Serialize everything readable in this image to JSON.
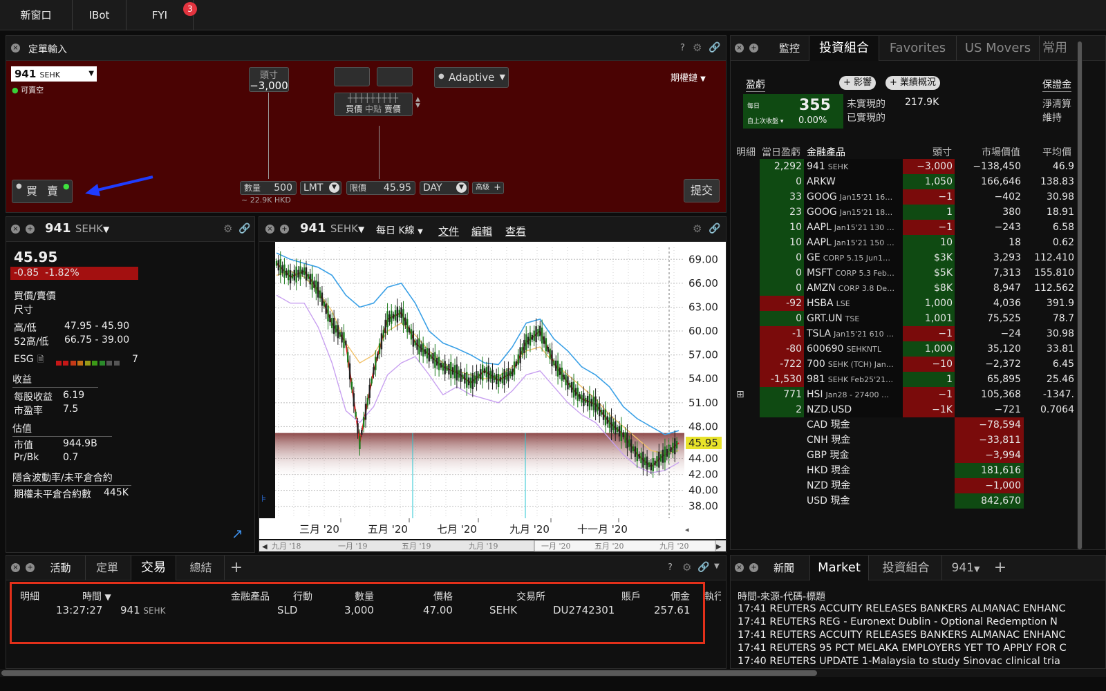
{
  "topbar": {
    "tabs": [
      "新窗口",
      "IBot",
      "FYI"
    ],
    "fyi_badge": "3"
  },
  "order_entry": {
    "title": "定單輸入",
    "symbol": "941",
    "exchange": "SEHK",
    "shortable": "可賣空",
    "position_label": "頭寸",
    "position_value": "−3,000",
    "bid_label": "買價",
    "mid_label": "中點",
    "ask_label": "賣價",
    "algo": "Adaptive",
    "options_chain": "期權鏈",
    "buy": "買",
    "sell": "賣",
    "qty_label": "數量",
    "qty_value": "500",
    "notional": "~ 22.9K HKD",
    "order_type": "LMT",
    "limit_label": "限價",
    "limit_value": "45.95",
    "tif": "DAY",
    "advanced": "高級",
    "submit": "提交"
  },
  "quote_panel": {
    "symbol": "941",
    "exchange": "SEHK",
    "last": "45.95",
    "change": "-0.85",
    "change_pct": "-1.82%",
    "bid_ask_label": "買價/賣價",
    "size_label": "尺寸",
    "hilo_label": "高/低",
    "hilo_value": "47.95 - 45.90",
    "hilo52_label": "52高/低",
    "hilo52_value": "66.75 - 39.00",
    "esg_label": "ESG",
    "esg_value": "7",
    "earnings_section": "收益",
    "eps_label": "每股收益",
    "eps_value": "6.19",
    "pe_label": "市盈率",
    "pe_value": "7.5",
    "valuation_section": "估值",
    "mktcap_label": "市值",
    "mktcap_value": "944.9B",
    "pb_label": "Pr/Bk",
    "pb_value": "0.7",
    "iv_section": "隱含波動率/未平倉合約",
    "oi_label": "期權未平倉合約數",
    "oi_value": "445K"
  },
  "chart_panel": {
    "symbol": "941",
    "exchange": "SEHK",
    "interval": "每日 K線",
    "menus": [
      "文件",
      "編輯",
      "查看"
    ],
    "last_price_tag": "45.95",
    "nav_labels": [
      "九月 '18",
      "一月 '19",
      "五月 '19",
      "九月 '19",
      "一月 '20",
      "五月 '20",
      "九月 '20"
    ]
  },
  "chart_data": {
    "type": "line",
    "title": "",
    "y_ticks": [
      69.0,
      66.0,
      63.0,
      60.0,
      57.0,
      54.0,
      51.0,
      48.0,
      44.0,
      42.0,
      40.0,
      38.0
    ],
    "ylim": [
      36.5,
      70.5
    ],
    "x_ticks": [
      "三月 '20",
      "五月 '20",
      "七月 '20",
      "九月 '20",
      "十一月 '20"
    ],
    "series": [
      {
        "values": [
          68.5,
          66.8,
          67.5,
          65.2,
          61.0,
          58.5,
          46.0,
          55.0,
          61.5,
          62.3,
          58.5,
          57.0,
          55.5,
          54.8,
          53.5,
          55.0,
          53.8,
          54.8,
          58.6,
          60.0,
          56.0,
          53.5,
          51.5,
          50.8,
          48.5,
          47.0,
          44.5,
          43.0,
          44.5,
          45.95
        ]
      },
      {
        "values": [
          67.0,
          67.5,
          66.8,
          65.0,
          62.5,
          58.5,
          56.0,
          57.0,
          60.0,
          61.0,
          59.5,
          57.5,
          56.0,
          55.0,
          54.5,
          54.0,
          54.3,
          55.5,
          57.5,
          58.0,
          56.0,
          54.5,
          53.0,
          51.5,
          49.5,
          48.0,
          46.5,
          45.0,
          44.6,
          45.0
        ]
      },
      {
        "values": [
          69.8,
          69.0,
          68.5,
          68.0,
          67.0,
          64.5,
          63.0,
          63.5,
          65.5,
          66.0,
          63.5,
          60.0,
          58.5,
          57.8,
          57.0,
          56.0,
          55.8,
          58.0,
          61.0,
          61.5,
          59.0,
          57.5,
          55.5,
          54.5,
          53.0,
          50.5,
          49.0,
          48.0,
          47.0,
          47.5
        ]
      },
      {
        "values": [
          64.5,
          63.5,
          63.5,
          60.5,
          56.0,
          50.0,
          48.5,
          50.5,
          54.5,
          56.0,
          56.8,
          54.5,
          52.0,
          53.0,
          52.0,
          51.5,
          51.0,
          52.5,
          54.5,
          55.0,
          53.0,
          51.0,
          49.5,
          48.5,
          46.5,
          44.5,
          43.0,
          42.2,
          42.5,
          43.5
        ]
      }
    ]
  },
  "portfolio_panel": {
    "tabs": [
      "監控",
      "投資組合",
      "Favorites",
      "US Movers",
      "常用"
    ],
    "pnl_label": "盈虧",
    "impact_btn": "+ 影響",
    "overview_btn": "+ 業績概況",
    "margin_label": "保證金",
    "daily_label": "每日",
    "daily_value": "355",
    "since_close_label": "自上次收盤",
    "since_close_pct": "0.00%",
    "unrealized_label": "未實現的",
    "unrealized_value": "217.9K",
    "realized_label": "已實現的",
    "net_liq_label": "淨清算",
    "maintenance_label": "維持",
    "columns": [
      "明細",
      "當日盈虧",
      "金融產品",
      "頭寸",
      "市場價值",
      "平均價"
    ],
    "rows": [
      {
        "pnl": "2,292",
        "sym": "941",
        "sub": "SEHK",
        "pos": "−3,000",
        "mv": "−138,450",
        "avg": "46.9"
      },
      {
        "pnl": "0",
        "sym": "ARKW",
        "sub": "",
        "pos": "1,050",
        "mv": "166,646",
        "avg": "138.83"
      },
      {
        "pnl": "33",
        "sym": "GOOG",
        "sub": "Jan15'21 16…",
        "pos": "−1",
        "mv": "−402",
        "avg": "30.98"
      },
      {
        "pnl": "23",
        "sym": "GOOG",
        "sub": "Jan15'21 18…",
        "pos": "1",
        "mv": "380",
        "avg": "18.91"
      },
      {
        "pnl": "10",
        "sym": "AAPL",
        "sub": "Jan15'21 130 …",
        "pos": "−1",
        "mv": "−243",
        "avg": "6.58"
      },
      {
        "pnl": "10",
        "sym": "AAPL",
        "sub": "Jan15'21 150 …",
        "pos": "10",
        "mv": "18",
        "avg": "0.62"
      },
      {
        "pnl": "0",
        "sym": "GE",
        "sub": "CORP 5.15 Jun1…",
        "pos": "$3K",
        "mv": "3,293",
        "avg": "112.410"
      },
      {
        "pnl": "0",
        "sym": "MSFT",
        "sub": "CORP 5.3 Feb…",
        "pos": "$5K",
        "mv": "7,313",
        "avg": "155.810"
      },
      {
        "pnl": "0",
        "sym": "AMZN",
        "sub": "CORP 3.8 De…",
        "pos": "$8K",
        "mv": "8,947",
        "avg": "112.562"
      },
      {
        "pnl": "-92",
        "sym": "HSBA",
        "sub": "LSE",
        "pos": "1,000",
        "mv": "4,036",
        "avg": "391.9"
      },
      {
        "pnl": "0",
        "sym": "GRT.UN",
        "sub": "TSE",
        "pos": "1,001",
        "mv": "75,525",
        "avg": "78.7"
      },
      {
        "pnl": "-1",
        "sym": "TSLA",
        "sub": "Jan15'21 610 …",
        "pos": "−1",
        "mv": "−24",
        "avg": "30.98"
      },
      {
        "pnl": "-80",
        "sym": "600690",
        "sub": "SEHKNTL",
        "pos": "1,000",
        "mv": "35,120",
        "avg": "33.81"
      },
      {
        "pnl": "-722",
        "sym": "700",
        "sub": "SEHK (TCH) Jan…",
        "pos": "−10",
        "mv": "−2,372",
        "avg": "6.45"
      },
      {
        "pnl": "-1,530",
        "sym": "981",
        "sub": "SEHK Feb25'21…",
        "pos": "1",
        "mv": "65,895",
        "avg": "25.46"
      },
      {
        "pnl": "771",
        "sym": "HSI",
        "sub": "Jan28 - 27400 …",
        "pos": "−1",
        "mv": "105,368",
        "avg": "-1347."
      },
      {
        "pnl": "2",
        "sym": "NZD.USD",
        "sub": "",
        "pos": "−1K",
        "mv": "−721",
        "avg": "0.7064"
      }
    ],
    "cash": [
      {
        "label": "CAD 現金",
        "value": "−78,594"
      },
      {
        "label": "CNH 現金",
        "value": "−33,811"
      },
      {
        "label": "GBP 現金",
        "value": "−3,994"
      },
      {
        "label": "HKD 現金",
        "value": "181,616"
      },
      {
        "label": "NZD 現金",
        "value": "−1,000"
      },
      {
        "label": "USD 現金",
        "value": "842,670"
      }
    ]
  },
  "trades_panel": {
    "tabs": [
      "活動",
      "定單",
      "交易",
      "總結"
    ],
    "columns": [
      "明細",
      "時間",
      "金融產品",
      "行動",
      "數量",
      "價格",
      "交易所",
      "賬戶",
      "佣金",
      "執行"
    ],
    "row": {
      "time": "13:27:27",
      "sym": "941",
      "sub": "SEHK",
      "action": "SLD",
      "qty": "3,000",
      "price": "47.00",
      "exch": "SEHK",
      "account": "DU2742301",
      "commission": "257.61"
    }
  },
  "news_panel": {
    "tabs": [
      "新聞",
      "Market",
      "投資組合",
      "941"
    ],
    "header": "時間-來源-代碼-標題",
    "items": [
      "17:41 REUTERS ACCUITY RELEASES BANKERS ALMANAC ENHANC",
      "17:41 REUTERS REG - Euronext Dublin - Optional Redemption N",
      "17:41 REUTERS ACCUITY RELEASES BANKERS ALMANAC ENHANC",
      "17:41 REUTERS 95 PCT MELAKA EMPLOYERS YET TO APPLY FOR C",
      "17:40 REUTERS UPDATE 1-Malaysia to study Sinovac clinical tria"
    ]
  }
}
